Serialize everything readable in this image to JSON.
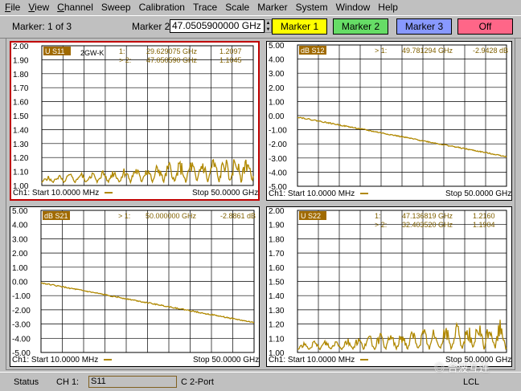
{
  "menu": [
    {
      "key": "F",
      "rest": "ile"
    },
    {
      "key": "V",
      "rest": "iew"
    },
    {
      "key": "C",
      "rest": "hannel"
    },
    {
      "key": "",
      "rest": "Sweep"
    },
    {
      "key": "",
      "rest": "Calibration"
    },
    {
      "key": "",
      "rest": "Trace"
    },
    {
      "key": "",
      "rest": "Scale"
    },
    {
      "key": "",
      "rest": "Marker"
    },
    {
      "key": "",
      "rest": "System"
    },
    {
      "key": "",
      "rest": "Window"
    },
    {
      "key": "",
      "rest": "Help"
    }
  ],
  "toolbar": {
    "marker_count": "Marker: 1 of 3",
    "marker_select_label": "Marker 2",
    "marker_value": "47.0505900000 GHz",
    "buttons": [
      {
        "label": "Marker 1",
        "color": "#ffff00"
      },
      {
        "label": "Marker 2",
        "color": "#66dd66"
      },
      {
        "label": "Marker 3",
        "color": "#8899ff"
      },
      {
        "label": "Off",
        "color": "#ff6688"
      }
    ]
  },
  "trace_color": "#b08800",
  "panels": [
    {
      "id": "p11",
      "name": "U S11",
      "active": true,
      "y_ticks": [
        "2.00",
        "1.90",
        "1.80",
        "1.70",
        "1.60",
        "1.50",
        "1.40",
        "1.30",
        "1.20",
        "1.10",
        "1.00"
      ],
      "extra_label": "2GW-K",
      "markers": [
        {
          "tag": "1:",
          "freq": "29.629075 GHz",
          "val": "1.2097"
        },
        {
          "tag": "> 2:",
          "freq": "47.050590 GHz",
          "val": "1.1045"
        }
      ],
      "start": "Ch1: Start  10.0000 MHz",
      "stop": "Stop  50.0000 GHz"
    },
    {
      "id": "p12",
      "name": "dB S12",
      "active": false,
      "y_ticks": [
        "5.00",
        "4.00",
        "3.00",
        "2.00",
        "1.00",
        "0.00",
        "-1.00",
        "-2.00",
        "-3.00",
        "-4.00",
        "-5.00"
      ],
      "extra_label": "",
      "markers": [
        {
          "tag": "> 1:",
          "freq": "49.781294 GHz",
          "val": "-2.9428 dB"
        }
      ],
      "start": "Ch1: Start  10.0000 MHz",
      "stop": "Stop  50.0000 GHz"
    },
    {
      "id": "p21",
      "name": "dB S21",
      "active": false,
      "y_ticks": [
        "5.00",
        "4.00",
        "3.00",
        "2.00",
        "1.00",
        "0.00",
        "-1.00",
        "-2.00",
        "-3.00",
        "-4.00",
        "-5.00"
      ],
      "extra_label": "",
      "markers": [
        {
          "tag": "> 1:",
          "freq": "50.000000 GHz",
          "val": "-2.8861 dB"
        }
      ],
      "start": "Ch1: Start  10.0000 MHz",
      "stop": "Stop  50.0000 GHz"
    },
    {
      "id": "p22",
      "name": "U S22",
      "active": false,
      "y_ticks": [
        "2.00",
        "1.90",
        "1.80",
        "1.70",
        "1.60",
        "1.50",
        "1.40",
        "1.30",
        "1.20",
        "1.10",
        "1.00"
      ],
      "extra_label": "",
      "markers": [
        {
          "tag": "1:",
          "freq": "47.136819 GHz",
          "val": "1.2160"
        },
        {
          "tag": "> 2:",
          "freq": "32.403520 GHz",
          "val": "1.1904"
        }
      ],
      "start": "Ch1: Start  10.0000 MHz",
      "stop": "Stop  50.0000 GHz"
    }
  ],
  "status": {
    "label": "Status",
    "channel": "CH 1:",
    "measurement": "S11",
    "cal": "C  2-Port",
    "remote": "LCL"
  },
  "watermark": "合波互连"
}
